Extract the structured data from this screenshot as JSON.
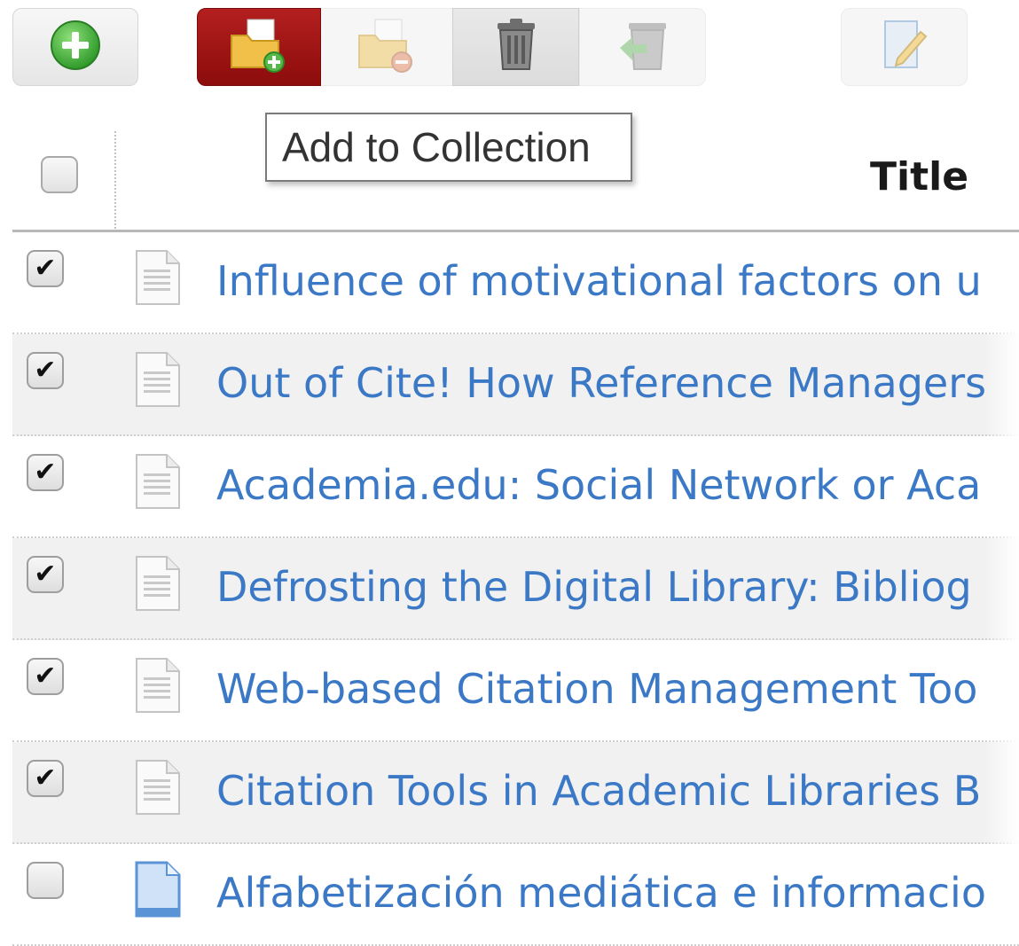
{
  "toolbar": {
    "buttons": [
      {
        "id": "new",
        "icon": "plus-circle-icon"
      },
      {
        "id": "add_to_collection",
        "icon": "folder-add-icon"
      },
      {
        "id": "remove_from_collection",
        "icon": "folder-remove-icon"
      },
      {
        "id": "move_to_trash",
        "icon": "trash-icon"
      },
      {
        "id": "restore",
        "icon": "restore-trash-icon"
      },
      {
        "id": "edit",
        "icon": "edit-document-icon"
      }
    ]
  },
  "tooltip": {
    "text": "Add to Collection"
  },
  "table": {
    "header": {
      "title": "Title"
    },
    "rows": [
      {
        "title": "Influence of motivational factors on u",
        "checked": true,
        "icon": "document-icon"
      },
      {
        "title": "Out of Cite! How Reference Managers",
        "checked": true,
        "icon": "document-icon"
      },
      {
        "title": "Academia.edu: Social Network or Aca",
        "checked": true,
        "icon": "document-icon"
      },
      {
        "title": "Defrosting the Digital Library: Bibliog",
        "checked": true,
        "icon": "document-icon"
      },
      {
        "title": "Web-based Citation Management Too",
        "checked": true,
        "icon": "document-icon"
      },
      {
        "title": "Citation Tools in Academic Libraries B",
        "checked": true,
        "icon": "document-icon"
      },
      {
        "title": "Alfabetización mediática e informacio",
        "checked": false,
        "icon": "blue-document-icon"
      }
    ]
  },
  "colors": {
    "link": "#3b79c7",
    "active_button": "#a31515"
  }
}
